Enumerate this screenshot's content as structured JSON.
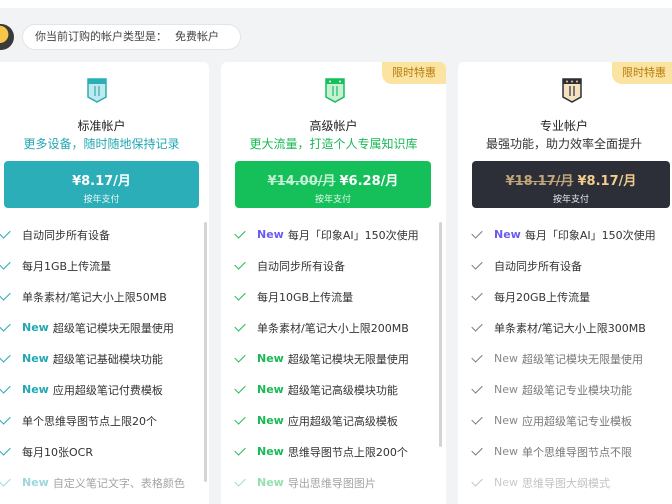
{
  "account": {
    "label": "你当前订购的帐户类型是：",
    "type": "免费帐户"
  },
  "plans": {
    "standard": {
      "name": "标准帐户",
      "subtitle": "更多设备，随时随地保持记录",
      "price": "¥8.17/月",
      "period": "按年支付",
      "features": [
        {
          "text": "自动同步所有设备"
        },
        {
          "text": "每月1GB上传流量"
        },
        {
          "text": "单条素材/笔记大小上限50MB"
        },
        {
          "new": "New",
          "text": "超级笔记模块无限量使用"
        },
        {
          "new": "New",
          "text": "超级笔记基础模块功能"
        },
        {
          "new": "New",
          "text": "应用超级笔记付费模板"
        },
        {
          "text": "单个思维导图节点上限20个"
        },
        {
          "text": "每月10张OCR"
        },
        {
          "new": "New",
          "text": "自定义笔记文字、表格颜色"
        }
      ]
    },
    "advanced": {
      "promo": "限时特惠",
      "name": "高级帐户",
      "subtitle": "更大流量，打造个人专属知识库",
      "old_price": "¥14.00/月",
      "price": "¥6.28/月",
      "period": "按年支付",
      "features": [
        {
          "new": "New",
          "text": "每月「印象AI」150次使用"
        },
        {
          "text": "自动同步所有设备"
        },
        {
          "text": "每月10GB上传流量"
        },
        {
          "text": "单条素材/笔记大小上限200MB"
        },
        {
          "new": "New",
          "text": "超级笔记模块无限量使用"
        },
        {
          "new": "New",
          "text": "超级笔记高级模块功能"
        },
        {
          "new": "New",
          "text": "应用超级笔记高级模板"
        },
        {
          "new": "New",
          "text": "思维导图节点上限200个"
        },
        {
          "new": "New",
          "text": "导出思维导图图片"
        }
      ]
    },
    "professional": {
      "promo": "限时特惠",
      "name": "专业帐户",
      "subtitle": "最强功能，助力效率全面提升",
      "old_price": "¥18.17/月",
      "price": "¥8.17/月",
      "period": "按年支付",
      "features": [
        {
          "new": "New",
          "text": "每月「印象AI」150次使用"
        },
        {
          "text": "自动同步所有设备"
        },
        {
          "text": "每月20GB上传流量"
        },
        {
          "text": "单条素材/笔记大小上限300MB"
        },
        {
          "new": "New",
          "text": "超级笔记模块无限量使用"
        },
        {
          "new": "New",
          "text": "超级笔记专业模块功能"
        },
        {
          "new": "New",
          "text": "应用超级笔记专业模板"
        },
        {
          "new": "New",
          "text": "单个思维导图节点不限"
        },
        {
          "new": "New",
          "text": "思维导图大纲模式"
        }
      ]
    }
  },
  "colors": {
    "standard": "#2baeb7",
    "advanced": "#15c05a",
    "professional": "#2c2e38",
    "promo_bg": "#fbe3a1"
  }
}
